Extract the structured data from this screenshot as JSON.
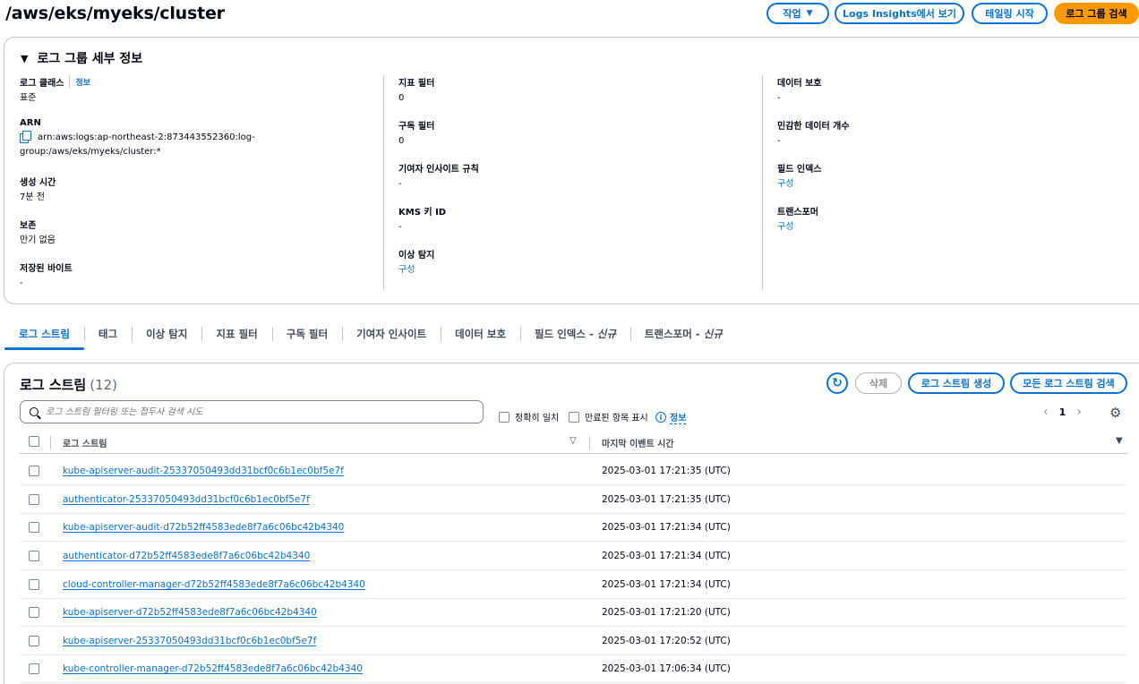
{
  "header": {
    "title": "/aws/eks/myeks/cluster",
    "buttons": {
      "actions": "작업",
      "logs_insights": "Logs Insights에서 보기",
      "tailing": "테일링 시작",
      "search_group": "로그 그룹 검색"
    }
  },
  "details": {
    "title": "로그 그룹 세부 정보",
    "log_class_label": "로그 클래스",
    "info_label": "정보",
    "log_class_value": "표준",
    "arn_label": "ARN",
    "arn_value_line1": "arn:aws:logs:ap-northeast-2:873443552360:log-",
    "arn_value_line2": "group:/aws/eks/myeks/cluster:*",
    "created_label": "생성 시간",
    "created_value": "7분 전",
    "retention_label": "보존",
    "retention_value": "만기 없음",
    "stored_bytes_label": "저장된 바이트",
    "stored_bytes_value": "-",
    "metric_filter_label": "지표 필터",
    "metric_filter_value": "0",
    "subscription_filter_label": "구독 필터",
    "subscription_filter_value": "0",
    "contributor_rules_label": "기여자 인사이트 규칙",
    "contributor_rules_value": "-",
    "kms_label": "KMS 키 ID",
    "kms_value": "-",
    "anomaly_label": "이상 탐지",
    "anomaly_value": "구성",
    "data_protection_label": "데이터 보호",
    "data_protection_value": "-",
    "sensitive_count_label": "민감한 데이터 개수",
    "sensitive_count_value": "-",
    "field_index_label": "필드 인덱스",
    "field_index_value": "구성",
    "transformer_label": "트랜스포머",
    "transformer_value": "구성"
  },
  "tabs": [
    {
      "label": "로그 스트림",
      "suffix": ""
    },
    {
      "label": "태그",
      "suffix": ""
    },
    {
      "label": "이상 탐지",
      "suffix": ""
    },
    {
      "label": "지표 필터",
      "suffix": ""
    },
    {
      "label": "구독 필터",
      "suffix": ""
    },
    {
      "label": "기여자 인사이트",
      "suffix": ""
    },
    {
      "label": "데이터 보호",
      "suffix": ""
    },
    {
      "label": "필드 인덱스 -",
      "suffix": "신규"
    },
    {
      "label": "트랜스포머 -",
      "suffix": "신규"
    }
  ],
  "streams": {
    "title": "로그 스트림",
    "count": "(12)",
    "delete_label": "삭제",
    "create_label": "로그 스트림 생성",
    "search_all_label": "모든 로그 스트림 검색",
    "search_placeholder": "로그 스트림 필터링 또는 접두사 검색 시도",
    "exact_match_label": "정확히 일치",
    "show_expired_label": "만료된 항목 표시",
    "info_label": "정보",
    "page": "1",
    "col_name": "로그 스트림",
    "col_time": "마지막 이벤트 시간",
    "rows": [
      {
        "name": "kube-apiserver-audit-25337050493dd31bcf0c6b1ec0bf5e7f",
        "time": "2025-03-01 17:21:35 (UTC)"
      },
      {
        "name": "authenticator-25337050493dd31bcf0c6b1ec0bf5e7f",
        "time": "2025-03-01 17:21:35 (UTC)"
      },
      {
        "name": "kube-apiserver-audit-d72b52ff4583ede8f7a6c06bc42b4340",
        "time": "2025-03-01 17:21:34 (UTC)"
      },
      {
        "name": "authenticator-d72b52ff4583ede8f7a6c06bc42b4340",
        "time": "2025-03-01 17:21:34 (UTC)"
      },
      {
        "name": "cloud-controller-manager-d72b52ff4583ede8f7a6c06bc42b4340",
        "time": "2025-03-01 17:21:34 (UTC)"
      },
      {
        "name": "kube-apiserver-d72b52ff4583ede8f7a6c06bc42b4340",
        "time": "2025-03-01 17:21:20 (UTC)"
      },
      {
        "name": "kube-apiserver-25337050493dd31bcf0c6b1ec0bf5e7f",
        "time": "2025-03-01 17:20:52 (UTC)"
      },
      {
        "name": "kube-controller-manager-d72b52ff4583ede8f7a6c06bc42b4340",
        "time": "2025-03-01 17:06:34 (UTC)"
      }
    ]
  },
  "colors": {
    "accent": "#0972d3",
    "primary_button": "#ff9900",
    "border": "#c6c6cd",
    "text": "#000716"
  }
}
